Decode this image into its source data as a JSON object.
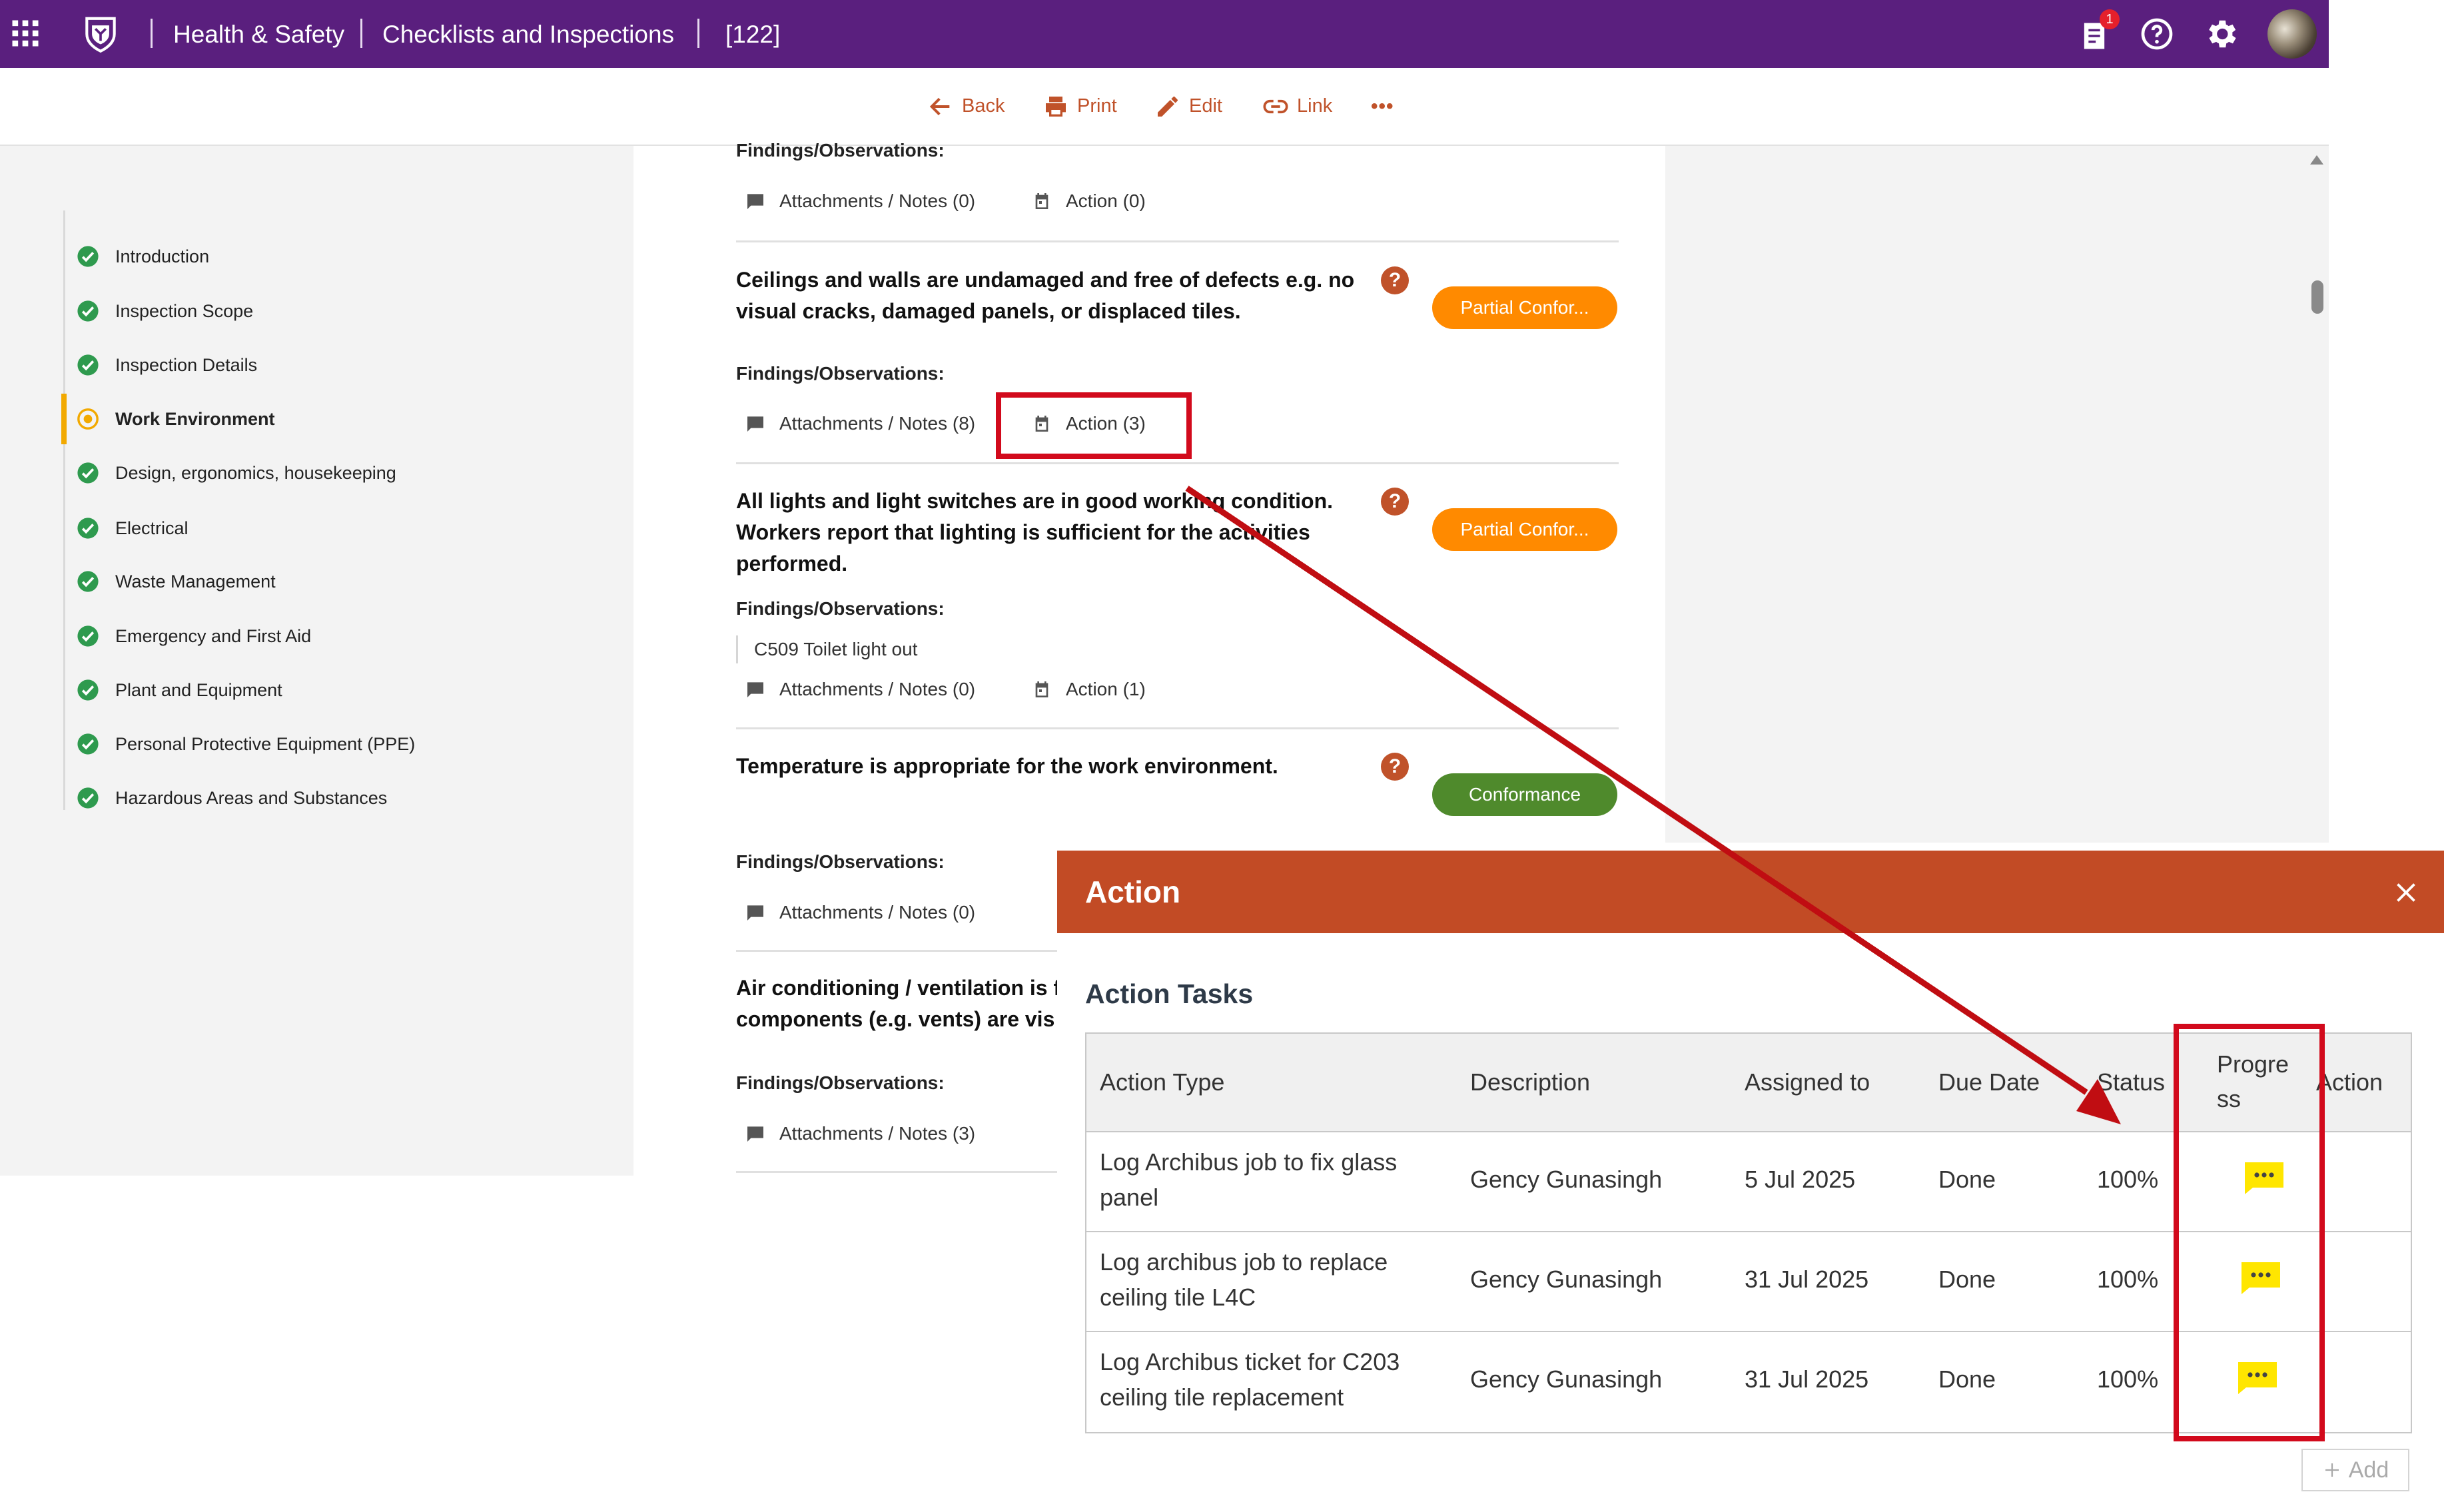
{
  "topbar": {
    "breadcrumb": [
      "Health & Safety",
      "Checklists and Inspections",
      "[122]"
    ],
    "notification_count": "1",
    "icons": [
      "apps-grid-icon",
      "university-crest-logo",
      "tasks-notification-icon",
      "help-icon",
      "settings-icon",
      "user-avatar"
    ]
  },
  "toolbar": {
    "back": "Back",
    "print": "Print",
    "edit": "Edit",
    "link": "Link",
    "more": "•••"
  },
  "sidebar": {
    "items": [
      {
        "label": "Introduction",
        "status": "complete"
      },
      {
        "label": "Inspection Scope",
        "status": "complete"
      },
      {
        "label": "Inspection Details",
        "status": "complete"
      },
      {
        "label": "Work Environment",
        "status": "in-progress"
      },
      {
        "label": "Design, ergonomics, housekeeping",
        "status": "complete"
      },
      {
        "label": "Electrical",
        "status": "complete"
      },
      {
        "label": "Waste Management",
        "status": "complete"
      },
      {
        "label": "Emergency and First Aid",
        "status": "complete"
      },
      {
        "label": "Plant and Equipment",
        "status": "complete"
      },
      {
        "label": "Personal Protective Equipment (PPE)",
        "status": "complete"
      },
      {
        "label": "Hazardous Areas and Substances",
        "status": "complete"
      }
    ]
  },
  "checklist": {
    "findings_label": "Findings/Observations:",
    "top": {
      "attachments": "Attachments / Notes (0)",
      "action": "Action (0)"
    },
    "items": [
      {
        "question": "Ceilings and walls are undamaged and free of defects e.g. no visual cracks, damaged panels, or displaced tiles.",
        "status": "Partial Confor...",
        "attachments": "Attachments / Notes (8)",
        "action": "Action (3)"
      },
      {
        "question": "All lights and light switches are in good working condition. Workers report that lighting is sufficient for the activities performed.",
        "status": "Partial Confor...",
        "note": "C509 Toilet light out",
        "attachments": "Attachments / Notes (0)",
        "action": "Action (1)"
      },
      {
        "question": "Temperature is appropriate for the work environment.",
        "status": "Conformance",
        "attachments": "Attachments / Notes (0)"
      },
      {
        "question_line1": "Air conditioning / ventilation is f",
        "question_line2": "components (e.g. vents) are vis",
        "attachments": "Attachments / Notes (3)"
      }
    ],
    "help_glyph": "?"
  },
  "modal": {
    "title": "Action",
    "section_title": "Action Tasks",
    "columns": [
      "Action Type",
      "Description",
      "Assigned to",
      "Due Date",
      "Status",
      "Progre ss",
      "Action"
    ],
    "rows": [
      {
        "type_line1": "Log Archibus job to fix glass",
        "type_line2": "panel",
        "description": "Gency Gunasingh",
        "assigned": "5 Jul 2025",
        "due": "Done",
        "status": "100%"
      },
      {
        "type_line1": "Log archibus job to replace",
        "type_line2": "ceiling tile L4C",
        "description": "Gency Gunasingh",
        "assigned": "31 Jul 2025",
        "due": "Done",
        "status": "100%"
      },
      {
        "type_line1": "Log Archibus ticket for C203",
        "type_line2": "ceiling tile replacement",
        "description": "Gency Gunasingh",
        "assigned": "31 Jul 2025",
        "due": "Done",
        "status": "100%"
      }
    ],
    "add_label": "Add"
  },
  "colors": {
    "topbar": "#5a1f7e",
    "accent": "#c0522a",
    "modal_header": "#c24b25",
    "partial": "#ff8a00",
    "conformance": "#4f8a2c",
    "complete": "#2e9a4e",
    "in_progress": "#f2a900",
    "highlight": "#d20a1c",
    "progress_chat": "#ffe600"
  }
}
